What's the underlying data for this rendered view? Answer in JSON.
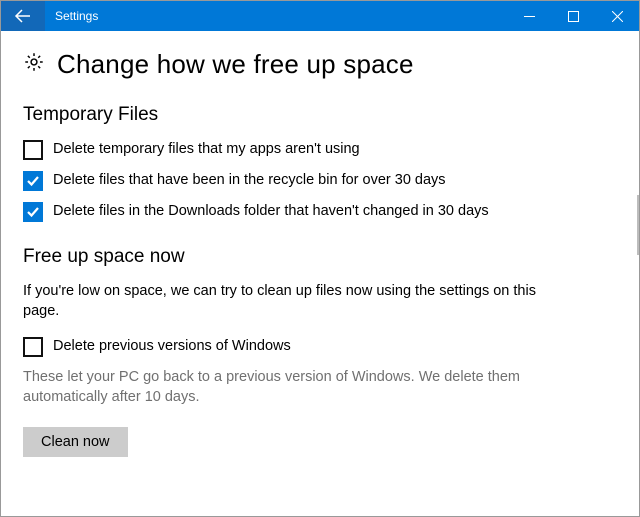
{
  "window": {
    "title": "Settings"
  },
  "page": {
    "title": "Change how we free up space"
  },
  "sections": {
    "temp": {
      "heading": "Temporary Files",
      "opt1": {
        "label": "Delete temporary files that my apps aren't using",
        "checked": false
      },
      "opt2": {
        "label": "Delete files that have been in the recycle bin for over 30 days",
        "checked": true
      },
      "opt3": {
        "label": "Delete files in the Downloads folder that haven't changed in 30 days",
        "checked": true
      }
    },
    "freeup": {
      "heading": "Free up space now",
      "body": "If you're low on space, we can try to clean up files now using the settings on this page.",
      "opt1": {
        "label": "Delete previous versions of Windows",
        "checked": false
      },
      "note": "These let your PC go back to a previous version of Windows. We delete them automatically after 10 days.",
      "button": "Clean now"
    }
  }
}
